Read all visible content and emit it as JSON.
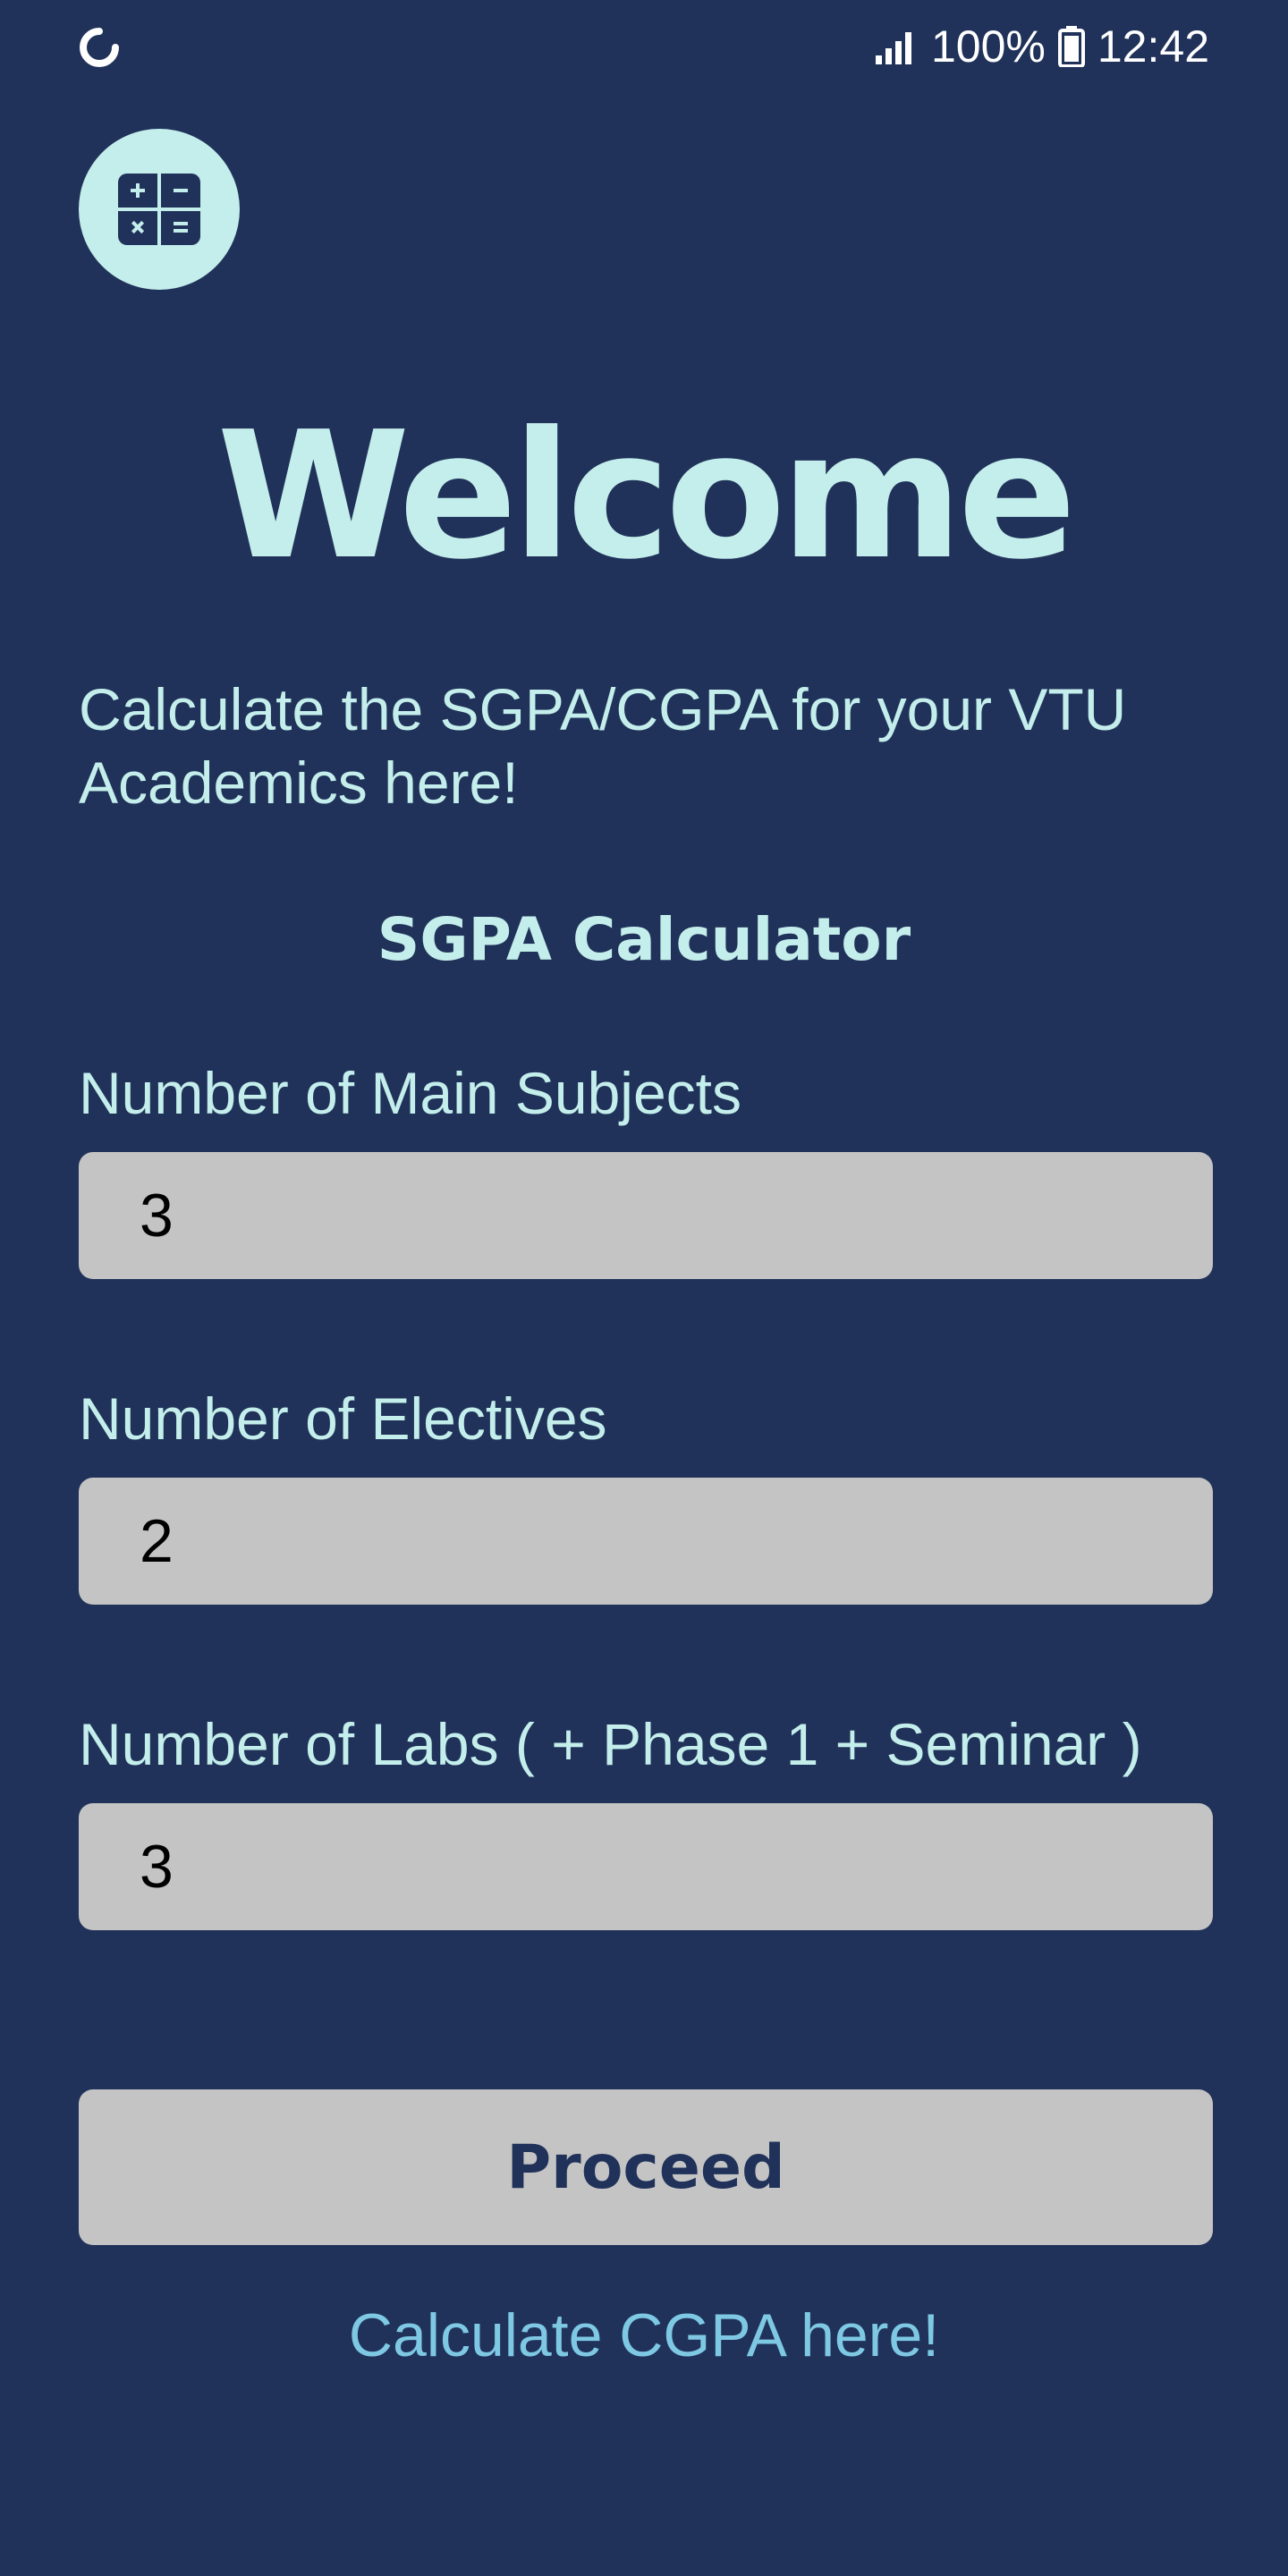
{
  "status_bar": {
    "battery_percent": "100%",
    "time": "12:42",
    "icons": [
      "loading-icon",
      "signal-icon",
      "battery-icon"
    ]
  },
  "app_icon": "calculator-icon",
  "welcome": "Welcome",
  "subtitle": "Calculate the SGPA/CGPA for your VTU Academics here!",
  "section_title": "SGPA Calculator",
  "fields": [
    {
      "label": "Number of Main Subjects",
      "value": "3"
    },
    {
      "label": "Number of Electives",
      "value": "2"
    },
    {
      "label": "Number of Labs ( + Phase 1 + Seminar )",
      "value": "3"
    }
  ],
  "proceed_label": "Proceed",
  "cgpa_link": "Calculate CGPA here!",
  "colors": {
    "background": "#20325a",
    "accent": "#c4eeeb",
    "input_bg": "#c4c4c4",
    "link": "#7ec8e3"
  }
}
